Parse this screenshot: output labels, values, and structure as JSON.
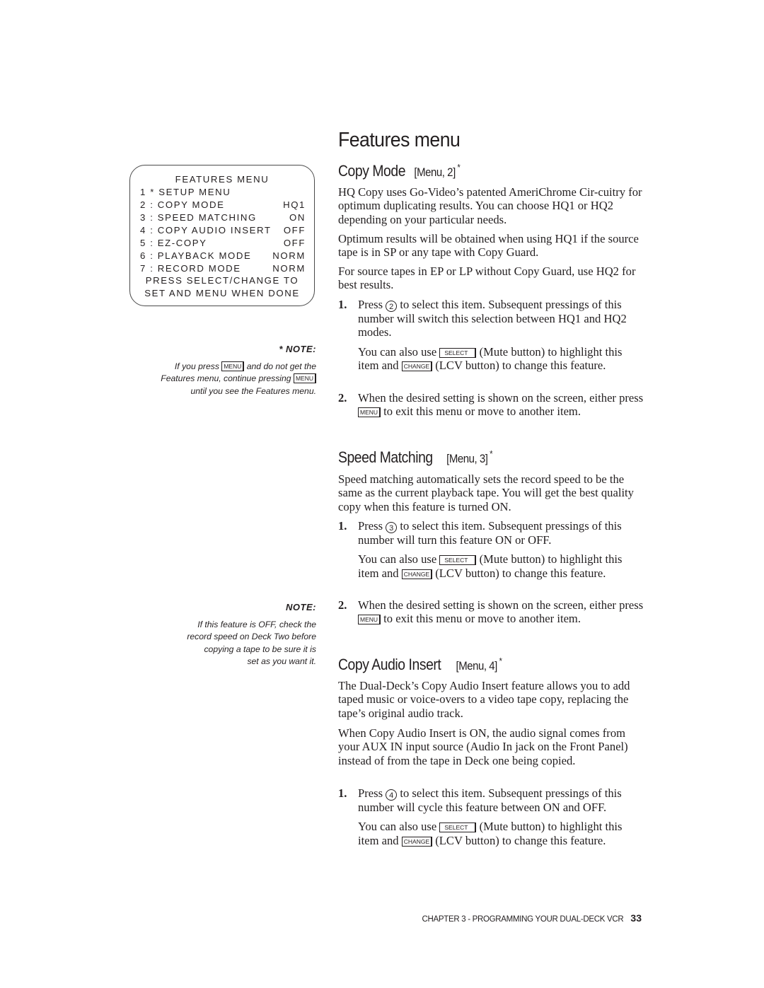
{
  "osd_menu": {
    "title": "FEATURES MENU",
    "rows": [
      {
        "label": "1 * SETUP MENU",
        "value": ""
      },
      {
        "label": "2 : COPY MODE",
        "value": "HQ1"
      },
      {
        "label": "3 : SPEED MATCHING",
        "value": "ON"
      },
      {
        "label": "4 : COPY AUDIO INSERT",
        "value": "OFF"
      },
      {
        "label": "5 : EZ-COPY",
        "value": "OFF"
      },
      {
        "label": "6 : PLAYBACK MODE",
        "value": "NORM"
      },
      {
        "label": "7 : RECORD MODE",
        "value": "NORM"
      }
    ],
    "footer_line1": "PRESS SELECT/CHANGE TO",
    "footer_line2": "SET AND MENU WHEN DONE"
  },
  "note1": {
    "heading": "*  NOTE:",
    "text_a": "If you press ",
    "key_a": "MENU",
    "text_b": " and do not get the",
    "text_c": "Features menu, continue pressing ",
    "key_b": "MENU",
    "text_d": "until you see the Features menu."
  },
  "note2": {
    "heading": "NOTE:",
    "lines": [
      "If this feature is OFF, check the",
      "record speed on Deck Two before",
      "copying a tape to be sure it is",
      "set as you want it."
    ]
  },
  "page_title": "Features menu",
  "keys": {
    "select": "SELECT",
    "change": "CHANGE",
    "menu": "MENU"
  },
  "copy_mode": {
    "heading": "Copy Mode",
    "ref": "[Menu, 2]",
    "star": "*",
    "paras": [
      "HQ Copy uses Go-Video’s patented AmeriChrome Cir-cuitry for optimum duplicating results. You can choose HQ1 or HQ2 depending on your particular needs.",
      "Optimum results will be obtained when using HQ1 if the source tape is in SP or any tape with Copy Guard.",
      "For source tapes in EP or LP without Copy Guard, use HQ2 for best results."
    ],
    "step1_num": "1.",
    "step1_pre": "Press ",
    "step1_key": "2",
    "step1_post": " to select this item. Subsequent pressings of this number will switch this selection between HQ1 and HQ2 modes.",
    "also_a": "You can also use ",
    "also_b": " (Mute button) to highlight this item and ",
    "also_c": " (LCV button) to change this feature.",
    "step2_num": "2.",
    "step2_pre": "When the desired setting is shown on the screen, either press ",
    "step2_post": " to exit this menu or move to another item."
  },
  "speed_matching": {
    "heading": "Speed Matching",
    "ref": "[Menu, 3]",
    "star": "*",
    "para": "Speed matching automatically sets the record speed to be the same as the current playback tape. You will get the best quality copy when this feature is turned ON.",
    "step1_num": "1.",
    "step1_pre": "Press ",
    "step1_key": "3",
    "step1_post": " to select this item. Subsequent pressings of this number will turn this feature ON or OFF.",
    "also_a": "You can also use ",
    "also_b": " (Mute button) to highlight this item and ",
    "also_c": " (LCV button) to change this feature.",
    "step2_num": "2.",
    "step2_pre": "When the desired setting is shown on the screen, either press ",
    "step2_post": " to exit this menu or move to another item."
  },
  "copy_audio_insert": {
    "heading": "Copy Audio Insert",
    "ref": "[Menu, 4]",
    "star": "*",
    "paras": [
      "The Dual-Deck’s Copy Audio Insert feature allows you to add taped music or voice-overs to a video tape copy, replacing the tape’s original audio track.",
      "When Copy Audio Insert is ON, the audio signal comes from your AUX IN input source (Audio In jack on the Front Panel) instead of from the tape in Deck one being copied."
    ],
    "step1_num": "1.",
    "step1_pre": "Press ",
    "step1_key": "4",
    "step1_post": " to select this item. Subsequent pressings of this number will cycle this feature between ON and OFF.",
    "also_a": "You can also use ",
    "also_b": " (Mute button) to highlight this item and ",
    "also_c": " (LCV button) to change this feature."
  },
  "footer": {
    "chapter": "CHAPTER 3 - PROGRAMMING YOUR DUAL-DECK VCR",
    "page": "33"
  }
}
